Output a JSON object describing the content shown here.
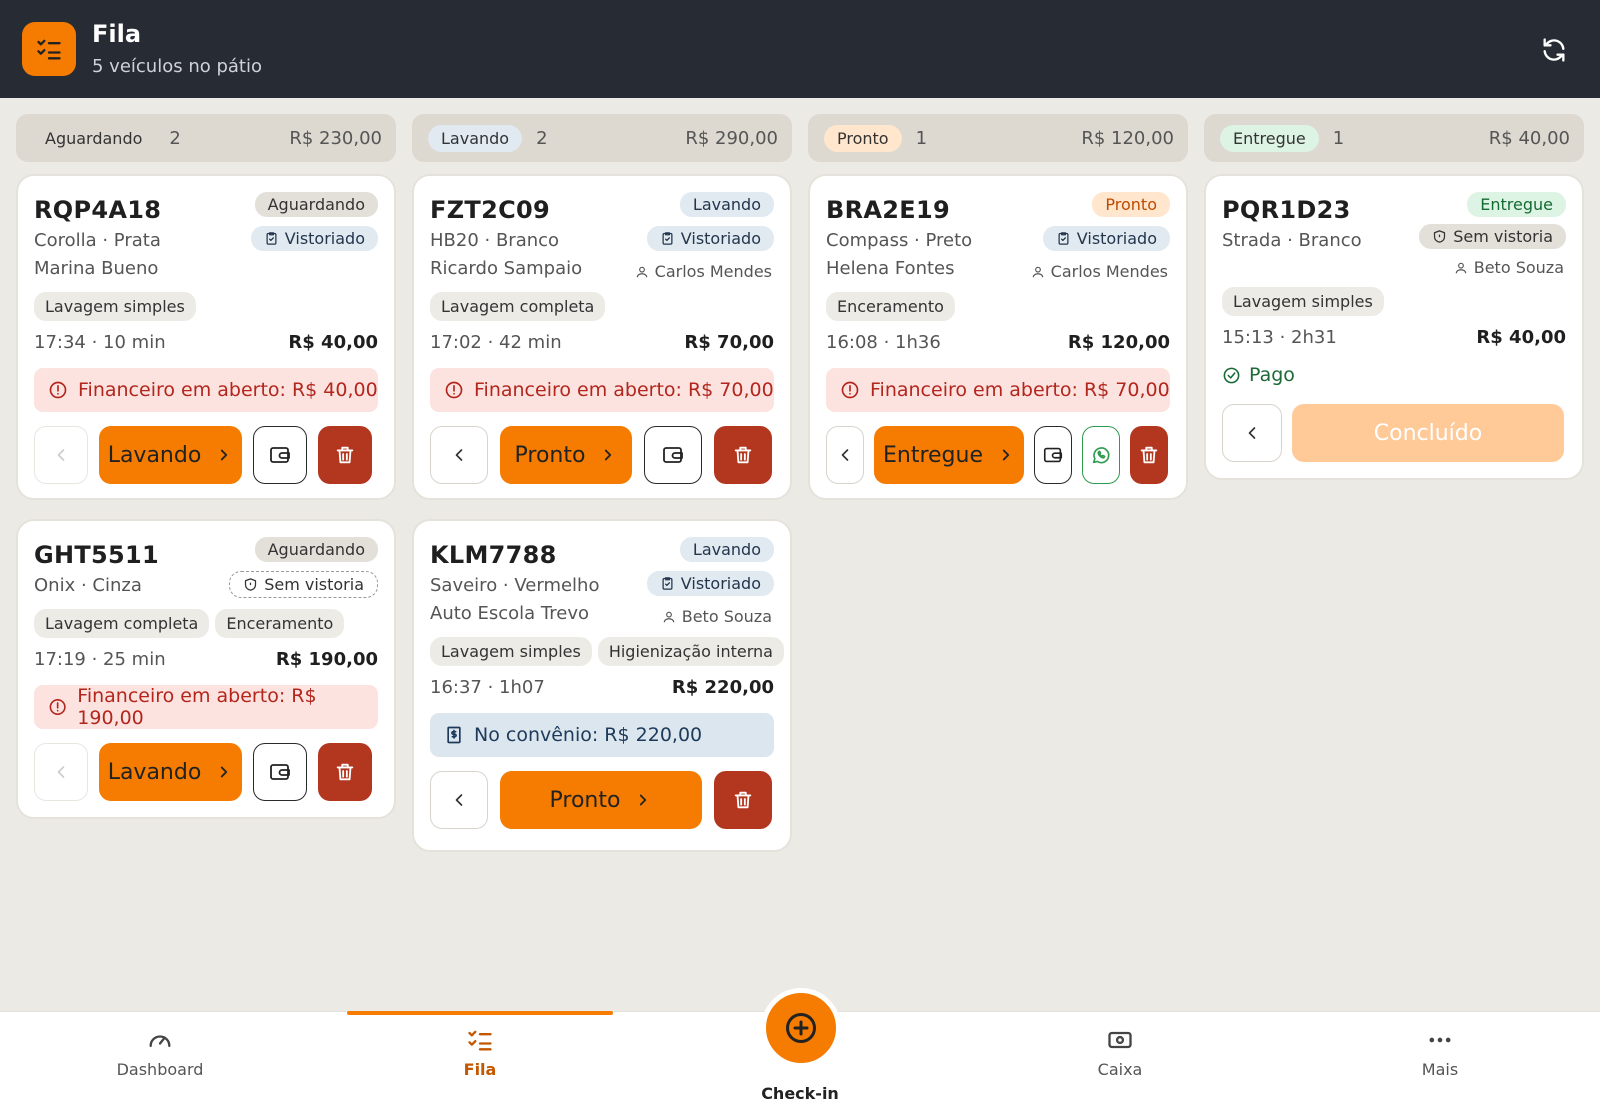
{
  "header": {
    "title": "Fila",
    "subtitle": "5 veículos no pátio"
  },
  "columns": [
    {
      "label": "Aguardando",
      "count": "2",
      "total": "R$ 230,00"
    },
    {
      "label": "Lavando",
      "count": "2",
      "total": "R$ 290,00"
    },
    {
      "label": "Pronto",
      "count": "1",
      "total": "R$ 120,00"
    },
    {
      "label": "Entregue",
      "count": "1",
      "total": "R$ 40,00"
    }
  ],
  "cards": {
    "rqp": {
      "plate": "RQP4A18",
      "vehicle": "Corolla · Prata",
      "client": "Marina Bueno",
      "status": "Aguardando",
      "inspection": "Vistoriado",
      "services": [
        "Lavagem simples"
      ],
      "time": "17:34 · 10 min",
      "price": "R$ 40,00",
      "alert": "Financeiro em aberto: R$ 40,00",
      "next": "Lavando"
    },
    "ght": {
      "plate": "GHT5511",
      "vehicle": "Onix · Cinza",
      "status": "Aguardando",
      "inspection": "Sem vistoria",
      "services": [
        "Lavagem completa",
        "Enceramento"
      ],
      "time": "17:19 · 25 min",
      "price": "R$ 190,00",
      "alert": "Financeiro em aberto: R$ 190,00",
      "next": "Lavando"
    },
    "fzt": {
      "plate": "FZT2C09",
      "vehicle": "HB20 · Branco",
      "client": "Ricardo Sampaio",
      "status": "Lavando",
      "inspection": "Vistoriado",
      "worker": "Carlos Mendes",
      "services": [
        "Lavagem completa"
      ],
      "time": "17:02 · 42 min",
      "price": "R$ 70,00",
      "alert": "Financeiro em aberto: R$ 70,00",
      "next": "Pronto"
    },
    "klm": {
      "plate": "KLM7788",
      "vehicle": "Saveiro · Vermelho",
      "client": "Auto Escola Trevo",
      "status": "Lavando",
      "inspection": "Vistoriado",
      "worker": "Beto Souza",
      "services": [
        "Lavagem simples",
        "Higienização interna"
      ],
      "time": "16:37 · 1h07",
      "price": "R$ 220,00",
      "alert": "No convênio: R$ 220,00",
      "next": "Pronto"
    },
    "bra": {
      "plate": "BRA2E19",
      "vehicle": "Compass · Preto",
      "client": "Helena Fontes",
      "status": "Pronto",
      "inspection": "Vistoriado",
      "worker": "Carlos Mendes",
      "services": [
        "Enceramento"
      ],
      "time": "16:08 · 1h36",
      "price": "R$ 120,00",
      "alert": "Financeiro em aberto: R$ 70,00",
      "next": "Entregue"
    },
    "pqr": {
      "plate": "PQR1D23",
      "vehicle": "Strada · Branco",
      "status": "Entregue",
      "inspection": "Sem vistoria",
      "worker": "Beto Souza",
      "services": [
        "Lavagem simples"
      ],
      "time": "15:13 · 2h31",
      "price": "R$ 40,00",
      "paid": "Pago",
      "done": "Concluído"
    }
  },
  "nav": {
    "dashboard": "Dashboard",
    "fila": "Fila",
    "checkin": "Check-in",
    "caixa": "Caixa",
    "mais": "Mais"
  },
  "colors": {
    "accent": "#F57C00",
    "danger": "#B3361F",
    "header_bg": "#272B34",
    "page_bg": "#ECEAE5"
  }
}
